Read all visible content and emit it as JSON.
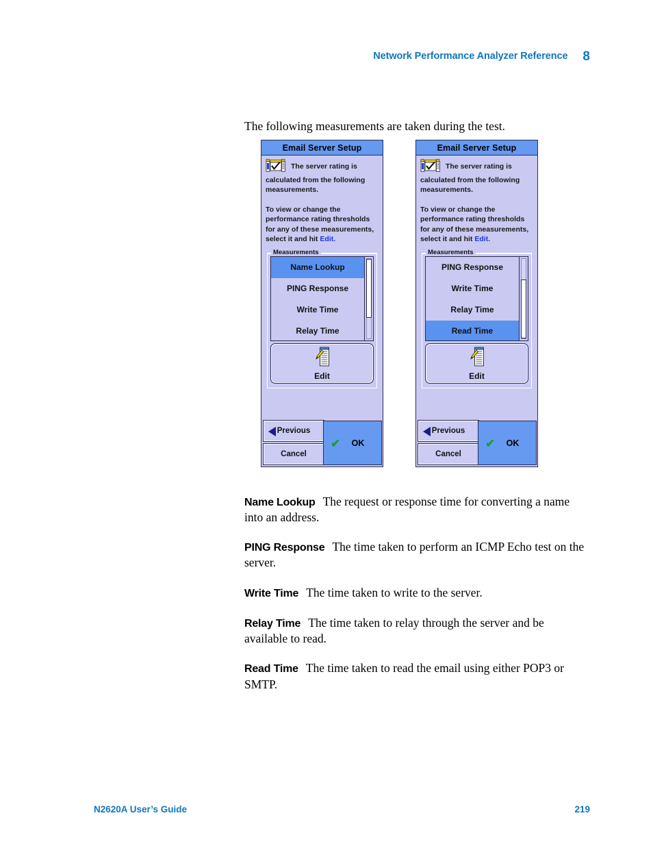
{
  "header": {
    "title": "Network Performance Analyzer Reference",
    "chapter_number": "8",
    "accent_color": "#1077bd"
  },
  "intro": {
    "text": "The following measurements are taken during the test."
  },
  "figure": {
    "screens": [
      {
        "title": "Email Server Setup",
        "icon": "server-rating-icon",
        "info_text_1": "The server rating is calculated from the following measurements.",
        "info_text_2_prefix": "To view or change the performance rating thresholds for any of these measurements, select it and hit ",
        "info_text_2_link": "Edit.",
        "group_label": "Measurements",
        "list_items": [
          {
            "label": "Name Lookup",
            "selected": true
          },
          {
            "label": "PING Response",
            "selected": false
          },
          {
            "label": "Write Time",
            "selected": false
          },
          {
            "label": "Relay Time",
            "selected": false
          }
        ],
        "scroll_thumb_top_pct": 2,
        "scroll_thumb_height_pct": 72,
        "edit_button_label": "Edit",
        "edit_button_icon": "edit-list-pencil-icon",
        "previous_button_label": "Previous",
        "cancel_button_label": "Cancel",
        "ok_button_label": "OK"
      },
      {
        "title": "Email Server Setup",
        "icon": "server-rating-icon",
        "info_text_1": "The server rating is calculated from the following measurements.",
        "info_text_2_prefix": "To view or change the performance rating thresholds for any of these measurements, select it and hit ",
        "info_text_2_link": "Edit.",
        "group_label": "Measurements",
        "list_items": [
          {
            "label": "PING Response",
            "selected": false
          },
          {
            "label": "Write Time",
            "selected": false
          },
          {
            "label": "Relay Time",
            "selected": false
          },
          {
            "label": "Read Time",
            "selected": true
          }
        ],
        "scroll_thumb_top_pct": 26,
        "scroll_thumb_height_pct": 72,
        "edit_button_label": "Edit",
        "edit_button_icon": "edit-list-pencil-icon",
        "previous_button_label": "Previous",
        "cancel_button_label": "Cancel",
        "ok_button_label": "OK"
      }
    ],
    "colors": {
      "titlebar": "#6699f0",
      "panel_background": "#c9c9f2",
      "selection": "#5a92ef",
      "link": "#1b34d8",
      "check": "#1c9e3a"
    }
  },
  "definitions": [
    {
      "term": "Name Lookup",
      "text": "The request or response time for converting a name into an address."
    },
    {
      "term": "PING Response",
      "text": "The time taken to perform an ICMP Echo test on the server."
    },
    {
      "term": "Write Time",
      "text": "The time taken to write to the server."
    },
    {
      "term": "Relay Time",
      "text": "The time taken to relay through the server and be available to read."
    },
    {
      "term": "Read Time",
      "text": "The time taken to read the email using either POP3 or SMTP."
    }
  ],
  "footer": {
    "guide": "N2620A User’s Guide",
    "page_number": "219"
  }
}
